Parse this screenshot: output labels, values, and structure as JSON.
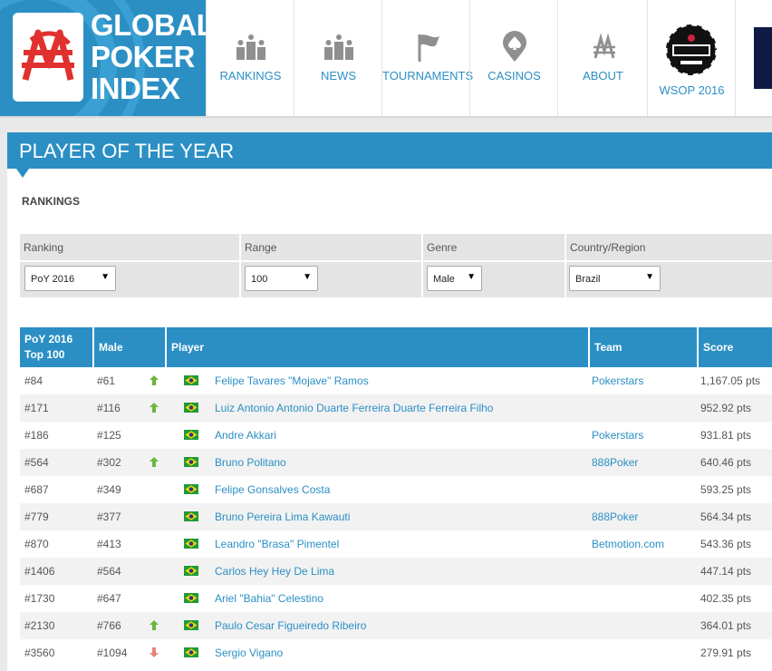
{
  "logo": {
    "line1": "GLOBAL",
    "line2": "POKER",
    "line3": "INDEX"
  },
  "nav": [
    {
      "label": "RANKINGS",
      "icon": "podium-icon"
    },
    {
      "label": "NEWS",
      "icon": "podium-icon"
    },
    {
      "label": "TOURNAMENTS",
      "icon": "flag-icon"
    },
    {
      "label": "CASINOS",
      "icon": "spade-pin-icon"
    },
    {
      "label": "ABOUT",
      "icon": "gpi-mark-icon"
    },
    {
      "label": "WSOP 2016",
      "icon": "wsop-logo-icon"
    }
  ],
  "page_title": "PLAYER OF THE YEAR",
  "section_label": "RANKINGS",
  "filters": [
    {
      "label": "Ranking",
      "value": "PoY 2016"
    },
    {
      "label": "Range",
      "value": "100"
    },
    {
      "label": "Genre",
      "value": "Male"
    },
    {
      "label": "Country/Region",
      "value": "Brazil"
    }
  ],
  "table": {
    "headers": {
      "rank_line1": "PoY 2016",
      "rank_line2": "Top 100",
      "male": "Male",
      "player": "Player",
      "team": "Team",
      "score": "Score"
    },
    "rows": [
      {
        "rank": "#84",
        "male": "#61",
        "trend": "up",
        "player": "Felipe Tavares \"Mojave\" Ramos",
        "team": "Pokerstars",
        "score": "1,167.05 pts"
      },
      {
        "rank": "#171",
        "male": "#116",
        "trend": "up",
        "player": "Luiz Antonio Antonio Duarte Ferreira Duarte Ferreira Filho",
        "team": "",
        "score": "952.92 pts"
      },
      {
        "rank": "#186",
        "male": "#125",
        "trend": "",
        "player": "Andre Akkari",
        "team": "Pokerstars",
        "score": "931.81 pts"
      },
      {
        "rank": "#564",
        "male": "#302",
        "trend": "up",
        "player": "Bruno Politano",
        "team": "888Poker",
        "score": "640.46 pts"
      },
      {
        "rank": "#687",
        "male": "#349",
        "trend": "",
        "player": "Felipe Gonsalves Costa",
        "team": "",
        "score": "593.25 pts"
      },
      {
        "rank": "#779",
        "male": "#377",
        "trend": "",
        "player": "Bruno Pereira Lima Kawauti",
        "team": "888Poker",
        "score": "564.34 pts"
      },
      {
        "rank": "#870",
        "male": "#413",
        "trend": "",
        "player": "Leandro \"Brasa\" Pimentel",
        "team": "Betmotion.com",
        "score": "543.36 pts"
      },
      {
        "rank": "#1406",
        "male": "#564",
        "trend": "",
        "player": "Carlos Hey Hey De Lima",
        "team": "",
        "score": "447.14 pts"
      },
      {
        "rank": "#1730",
        "male": "#647",
        "trend": "",
        "player": "Ariel \"Bahia\" Celestino",
        "team": "",
        "score": "402.35 pts"
      },
      {
        "rank": "#2130",
        "male": "#766",
        "trend": "up",
        "player": "Paulo Cesar Figueiredo Ribeiro",
        "team": "",
        "score": "364.01 pts"
      },
      {
        "rank": "#3560",
        "male": "#1094",
        "trend": "down",
        "player": "Sergio Vigano",
        "team": "",
        "score": "279.91 pts"
      }
    ]
  },
  "colors": {
    "brand_blue": "#2b8fc4",
    "trend_up": "#6ab73c",
    "trend_down": "#e8837a",
    "flag_green": "#1f9a3a",
    "flag_yellow": "#f6d600"
  }
}
